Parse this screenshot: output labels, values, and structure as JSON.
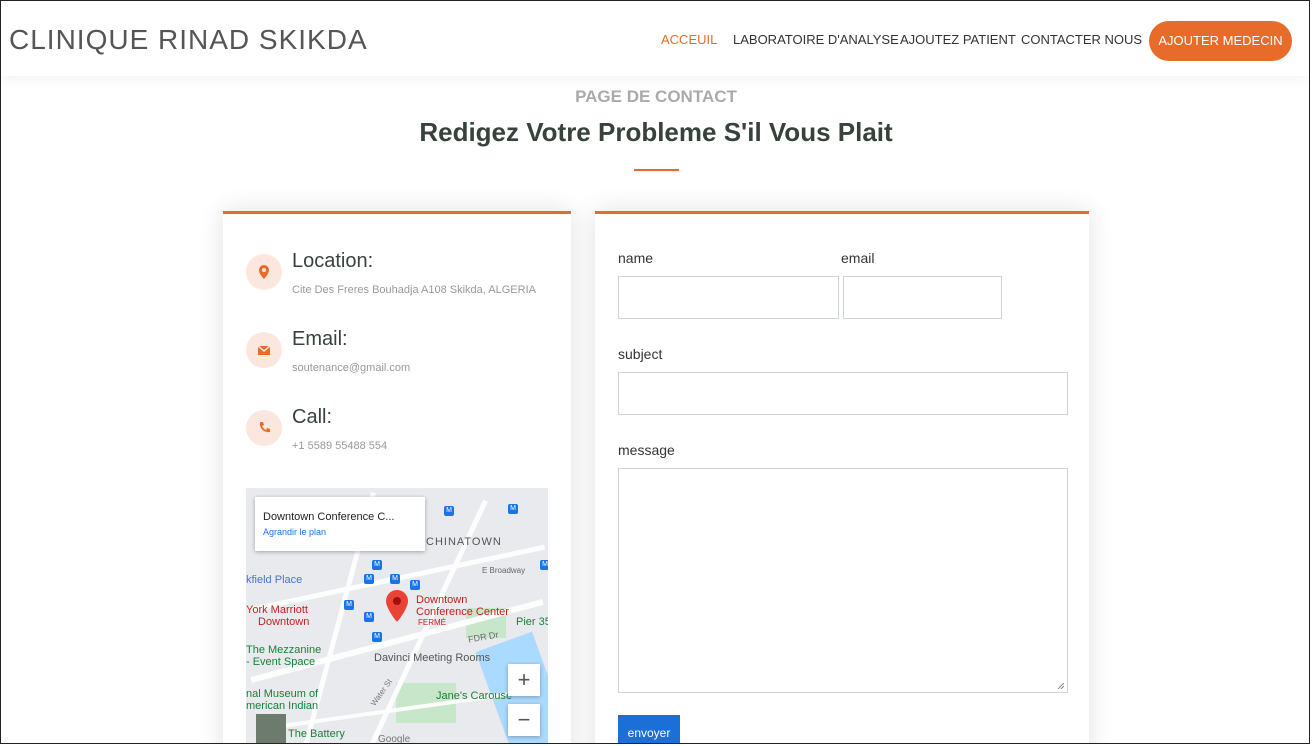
{
  "header": {
    "brand": "CLINIQUE RINAD SKIKDA",
    "nav": [
      "ACCEUIL",
      "LABORATOIRE D'ANALYSE",
      "AJOUTEZ PATIENT",
      "CONTACTER NOUS"
    ],
    "cta": "AJOUTER MEDECIN"
  },
  "section": {
    "subtitle": "PAGE DE CONTACT",
    "title": "Redigez Votre Probleme S'il Vous Plait"
  },
  "info": {
    "location_title": "Location:",
    "location_text": "Cite Des Freres Bouhadja A108 Skikda, ALGERIA",
    "email_title": "Email:",
    "email_text": "soutenance@gmail.com",
    "call_title": "Call:",
    "call_text": "+1 5589 55488 554"
  },
  "map": {
    "popup_title": "Downtown Conference C...",
    "popup_link": "Agrandir le plan",
    "labels": {
      "chinatown": "CHINATOWN",
      "broadway": "E Broadway",
      "fieldplace": "kfield Place",
      "conf1": "Downtown",
      "conf2": "Conference Center",
      "ferme": "FERMÉ",
      "marriott1": "York Marriott",
      "marriott2": "Downtown",
      "pier": "Pier 35",
      "fdr": "FDR Dr",
      "mezz1": "The Mezzanine",
      "mezz2": "- Event Space",
      "davinci": "Davinci Meeting Rooms",
      "museum1": "nal Museum of",
      "museum2": "merican Indian",
      "janes": "Jane's Carouse",
      "water": "Water St",
      "battery": "The Battery",
      "google": "Google"
    },
    "zoom_in": "+",
    "zoom_out": "−"
  },
  "form": {
    "name_label": "name",
    "email_label": "email",
    "subject_label": "subject",
    "message_label": "message",
    "submit": "envoyer"
  },
  "colors": {
    "accent": "#e96b2a",
    "button_blue": "#1b6fd6"
  },
  "icons": {
    "location": "map-marker-icon",
    "email": "envelope-icon",
    "call": "phone-icon"
  }
}
